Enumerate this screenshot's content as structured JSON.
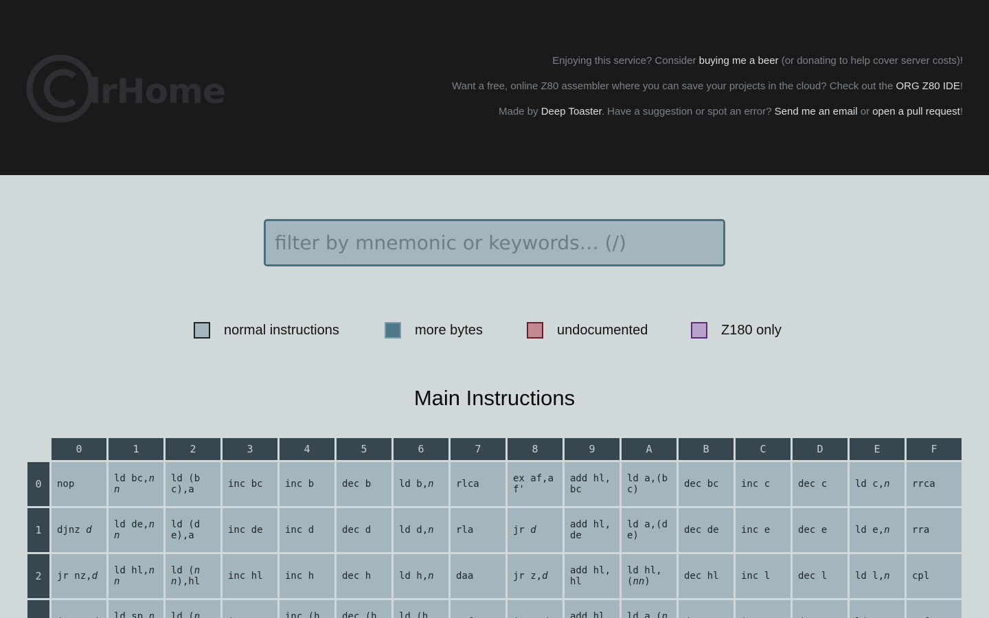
{
  "header": {
    "logo_text": "ClrHome",
    "line1": {
      "before": "Enjoying this service? Consider ",
      "link1": "buying me a beer",
      "after": " (or donating to help cover server costs)!"
    },
    "line2": {
      "before": "Want a free, online Z80 assembler where you can save your projects in the cloud? Check out the ",
      "link1": "ORG Z80 IDE",
      "after": "!"
    },
    "line3": {
      "before": "Made by ",
      "link1": "Deep Toaster",
      "middle": ". Have a suggestion or spot an error? ",
      "link2": "Send me an email",
      "middle2": " or ",
      "link3": "open a pull request",
      "after": "!"
    }
  },
  "search": {
    "placeholder": "filter by mnemonic or keywords… (/)"
  },
  "legend": [
    {
      "label": "normal instructions",
      "color": "#a4b6bd"
    },
    {
      "label": "more bytes",
      "color": "#4f7a8c"
    },
    {
      "label": "undocumented",
      "color": "#c28b92"
    },
    {
      "label": "Z180 only",
      "color": "#b7a3c7"
    }
  ],
  "section_title": "Main Instructions",
  "table": {
    "col_headers": [
      "0",
      "1",
      "2",
      "3",
      "4",
      "5",
      "6",
      "7",
      "8",
      "9",
      "A",
      "B",
      "C",
      "D",
      "E",
      "F"
    ],
    "row_headers": [
      "0",
      "1",
      "2",
      ""
    ],
    "rows": [
      [
        "nop",
        "ld bc,{nn}",
        "ld (bc),a",
        "inc bc",
        "inc b",
        "dec b",
        "ld b,{n}",
        "rlca",
        "ex af,af'",
        "add hl,bc",
        "ld a,(bc)",
        "dec bc",
        "inc c",
        "dec c",
        "ld c,{n}",
        "rrca"
      ],
      [
        "djnz {d}",
        "ld de,{nn}",
        "ld (de),a",
        "inc de",
        "inc d",
        "dec d",
        "ld d,{n}",
        "rla",
        "jr {d}",
        "add hl,de",
        "ld a,(de)",
        "dec de",
        "inc e",
        "dec e",
        "ld e,{n}",
        "rra"
      ],
      [
        "jr nz,{d}",
        "ld hl,{nn}",
        "ld ({nn}),hl",
        "inc hl",
        "inc h",
        "dec h",
        "ld h,{n}",
        "daa",
        "jr z,{d}",
        "add hl,hl",
        "ld hl,({nn})",
        "dec hl",
        "inc l",
        "dec l",
        "ld l,{n}",
        "cpl"
      ],
      [
        "jr nc,{d}",
        "ld sp,{nn}",
        "ld ({nn}),a",
        "inc sp",
        "inc (hl)",
        "dec (hl)",
        "ld (hl),{n}",
        "scf",
        "jr c,{d}",
        "add hl,sp",
        "ld a,({nn})",
        "dec sp",
        "inc a",
        "dec a",
        "ld a,{n}",
        "ccf"
      ]
    ]
  }
}
